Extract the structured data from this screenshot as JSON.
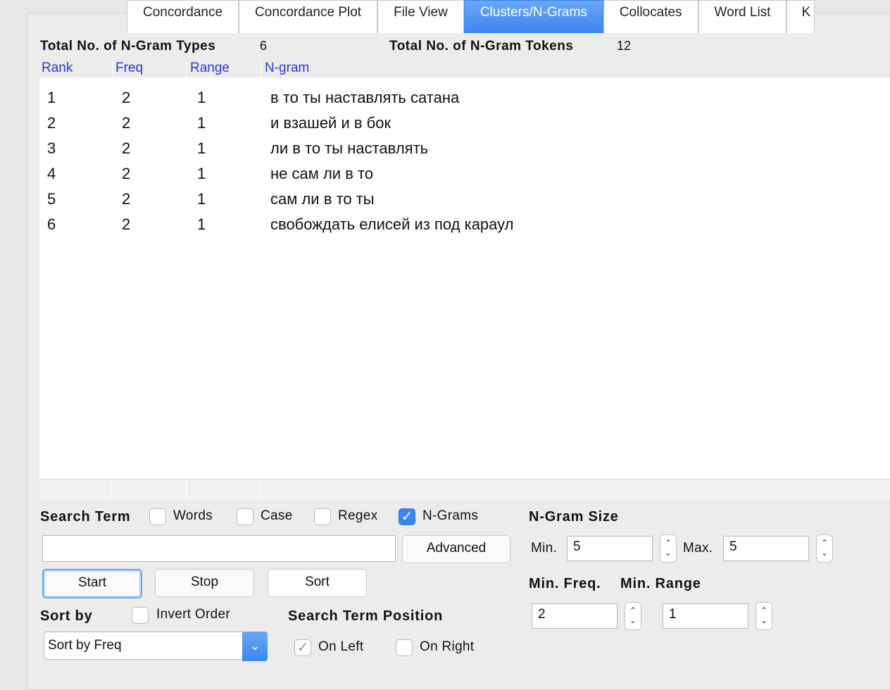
{
  "tabs": [
    "Concordance",
    "Concordance Plot",
    "File View",
    "Clusters/N-Grams",
    "Collocates",
    "Word List",
    "K"
  ],
  "active_tab": "Clusters/N-Grams",
  "totals": {
    "types_label": "Total No. of N-Gram Types",
    "types_value": "6",
    "tokens_label": "Total No. of N-Gram Tokens",
    "tokens_value": "12"
  },
  "columns": [
    "Rank",
    "Freq",
    "Range",
    "N-gram"
  ],
  "rows": [
    {
      "rank": "1",
      "freq": "2",
      "range": "1",
      "ngram": "в то ты наставлять сатана"
    },
    {
      "rank": "2",
      "freq": "2",
      "range": "1",
      "ngram": "и взашей и в бок"
    },
    {
      "rank": "3",
      "freq": "2",
      "range": "1",
      "ngram": "ли в то ты наставлять"
    },
    {
      "rank": "4",
      "freq": "2",
      "range": "1",
      "ngram": "не сам ли в то"
    },
    {
      "rank": "5",
      "freq": "2",
      "range": "1",
      "ngram": "сам ли в то ты"
    },
    {
      "rank": "6",
      "freq": "2",
      "range": "1",
      "ngram": "свобождать елисей из под караул"
    }
  ],
  "search": {
    "label": "Search Term",
    "words_label": "Words",
    "words_checked": false,
    "case_label": "Case",
    "case_checked": false,
    "regex_label": "Regex",
    "regex_checked": false,
    "ngrams_label": "N-Grams",
    "ngrams_checked": true,
    "term_value": "",
    "advanced_label": "Advanced"
  },
  "buttons": {
    "start": "Start",
    "stop": "Stop",
    "sort": "Sort"
  },
  "sort": {
    "label": "Sort by",
    "invert_label": "Invert Order",
    "invert_checked": false,
    "selected": "Sort by Freq"
  },
  "position": {
    "label": "Search Term Position",
    "left_label": "On Left",
    "left_checked": true,
    "right_label": "On Right",
    "right_checked": false
  },
  "ngram_size": {
    "label": "N-Gram Size",
    "min_label": "Min.",
    "min_value": "5",
    "max_label": "Max.",
    "max_value": "5"
  },
  "min_freq": {
    "label": "Min. Freq.",
    "value": "2"
  },
  "min_range": {
    "label": "Min. Range",
    "value": "1"
  },
  "icons": {
    "checkmark": "✓",
    "stepper": "up-down-stepper-icon",
    "dropdown": "chevron-down-icon"
  },
  "colors": {
    "accent": "#3b86ef",
    "header_text": "#2a39d8"
  }
}
